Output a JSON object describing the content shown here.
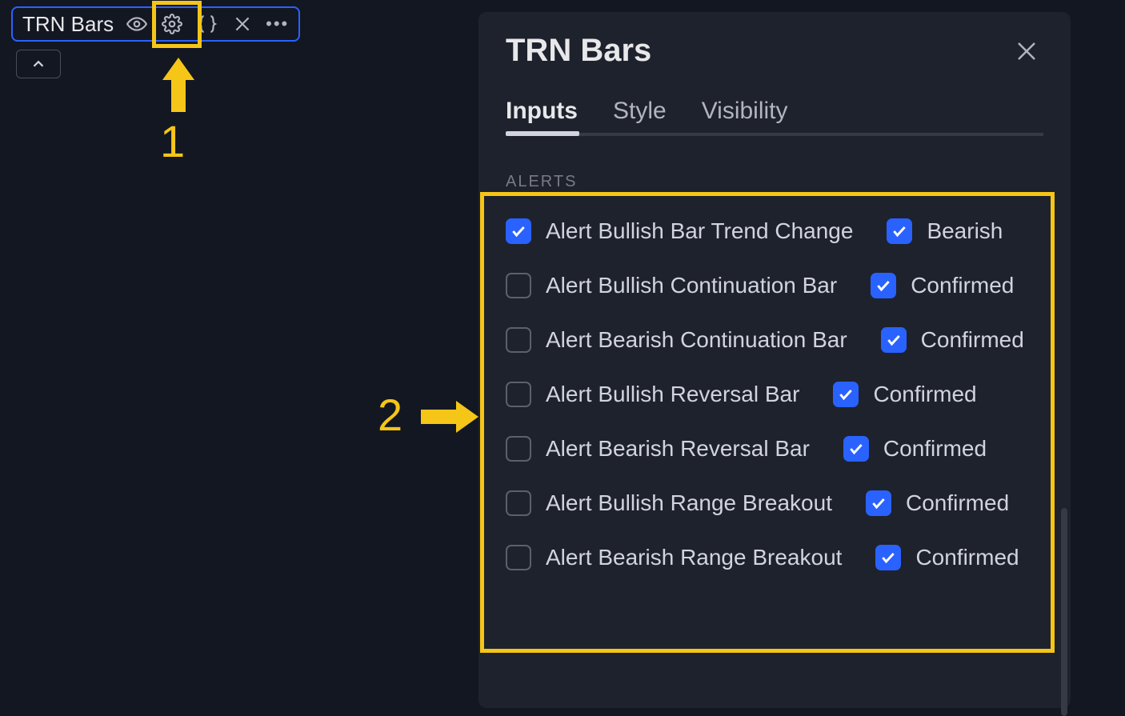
{
  "pill": {
    "title": "TRN Bars"
  },
  "annotations": {
    "one": "1",
    "two": "2"
  },
  "dialog": {
    "title": "TRN Bars",
    "tabs": {
      "inputs": "Inputs",
      "style": "Style",
      "visibility": "Visibility"
    },
    "section": "ALERTS",
    "rows": [
      {
        "primary_checked": true,
        "primary": "Alert Bullish Bar Trend Change",
        "secondary_checked": true,
        "secondary": "Bearish"
      },
      {
        "primary_checked": false,
        "primary": "Alert Bullish Continuation Bar",
        "secondary_checked": true,
        "secondary": "Confirmed"
      },
      {
        "primary_checked": false,
        "primary": "Alert Bearish Continuation Bar",
        "secondary_checked": true,
        "secondary": "Confirmed"
      },
      {
        "primary_checked": false,
        "primary": "Alert Bullish Reversal Bar",
        "secondary_checked": true,
        "secondary": "Confirmed"
      },
      {
        "primary_checked": false,
        "primary": "Alert Bearish Reversal Bar",
        "secondary_checked": true,
        "secondary": "Confirmed"
      },
      {
        "primary_checked": false,
        "primary": "Alert Bullish Range Breakout",
        "secondary_checked": true,
        "secondary": "Confirmed"
      },
      {
        "primary_checked": false,
        "primary": "Alert Bearish Range Breakout",
        "secondary_checked": true,
        "secondary": "Confirmed"
      }
    ]
  }
}
